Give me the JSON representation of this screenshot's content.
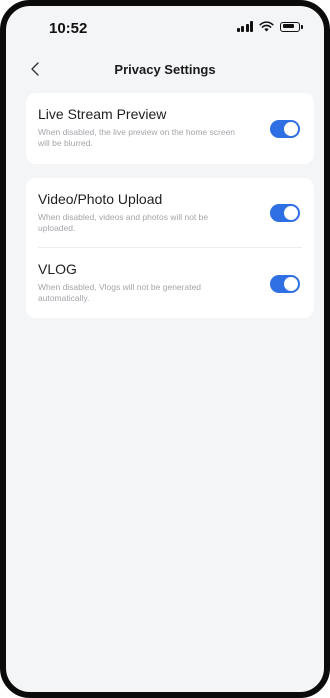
{
  "status_bar": {
    "time": "10:52"
  },
  "header": {
    "title": "Privacy Settings"
  },
  "settings": [
    {
      "title": "Live Stream Preview",
      "description": "When disabled, the live preview on the home screen will be blurred.",
      "enabled": true
    },
    {
      "title": "Video/Photo Upload",
      "description": "When disabled, videos and photos will not be uploaded.",
      "enabled": true
    },
    {
      "title": "VLOG",
      "description": "When disabled, Vlogs will not be generated automatically.",
      "enabled": true
    }
  ],
  "colors": {
    "accent": "#2f6fe4",
    "background": "#f4f5f7",
    "card": "#ffffff"
  },
  "icons": {
    "back": "chevron-left-icon",
    "signal": "signal-icon",
    "wifi": "wifi-icon",
    "battery": "battery-icon"
  }
}
